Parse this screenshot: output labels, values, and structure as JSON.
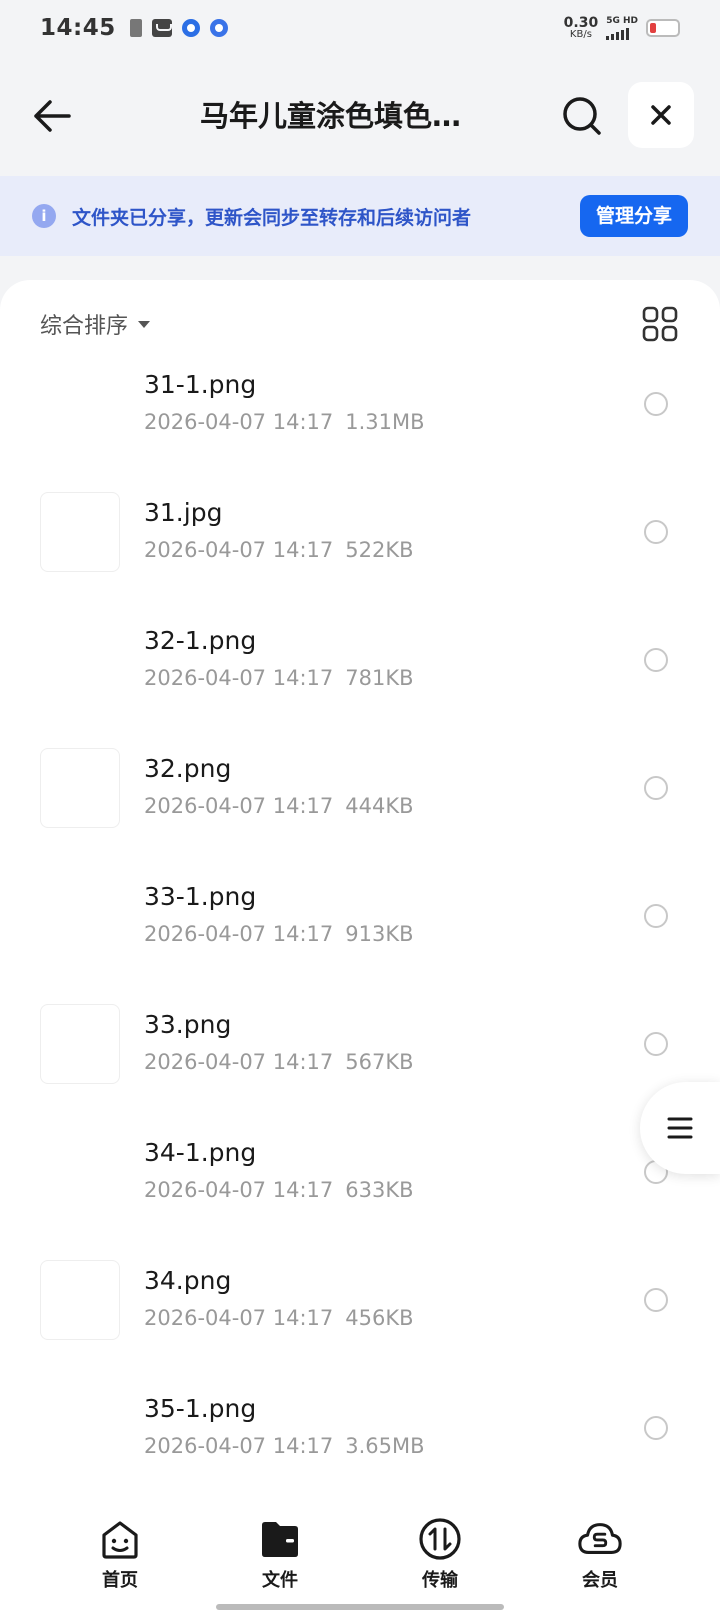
{
  "status_bar": {
    "time": "14:45",
    "net_speed_value": "0.30",
    "net_speed_unit": "KB/s",
    "signal_label": "5G HD",
    "battery_color": "#e24040"
  },
  "header": {
    "back_icon": "arrow-left-icon",
    "title": "马年儿童涂色填色…",
    "search_icon": "search-icon",
    "close_icon": "close-icon"
  },
  "share_banner": {
    "info_icon": "info-icon",
    "info_glyph": "i",
    "text": "文件夹已分享，更新会同步至转存和后续访问者",
    "manage_label": "管理分享",
    "accent_color": "#1667f0"
  },
  "toolbar": {
    "sort_label": "综合排序",
    "grid_icon": "grid-view-icon"
  },
  "files": [
    {
      "name": "31-1.png",
      "date": "2026-04-07 14:17",
      "size": "1.31MB",
      "thumb": "color"
    },
    {
      "name": "31.jpg",
      "date": "2026-04-07 14:17",
      "size": "522KB",
      "thumb": "line"
    },
    {
      "name": "32-1.png",
      "date": "2026-04-07 14:17",
      "size": "781KB",
      "thumb": "color"
    },
    {
      "name": "32.png",
      "date": "2026-04-07 14:17",
      "size": "444KB",
      "thumb": "line"
    },
    {
      "name": "33-1.png",
      "date": "2026-04-07 14:17",
      "size": "913KB",
      "thumb": "color"
    },
    {
      "name": "33.png",
      "date": "2026-04-07 14:17",
      "size": "567KB",
      "thumb": "line"
    },
    {
      "name": "34-1.png",
      "date": "2026-04-07 14:17",
      "size": "633KB",
      "thumb": "color"
    },
    {
      "name": "34.png",
      "date": "2026-04-07 14:17",
      "size": "456KB",
      "thumb": "line"
    },
    {
      "name": "35-1.png",
      "date": "2026-04-07 14:17",
      "size": "3.65MB",
      "thumb": "color"
    }
  ],
  "side_menu_icon": "menu-icon",
  "tabs": [
    {
      "label": "首页",
      "icon": "home-face-icon"
    },
    {
      "label": "文件",
      "icon": "folder-icon",
      "active": true
    },
    {
      "label": "传输",
      "icon": "transfer-icon"
    },
    {
      "label": "会员",
      "icon": "vip-cloud-icon"
    }
  ]
}
